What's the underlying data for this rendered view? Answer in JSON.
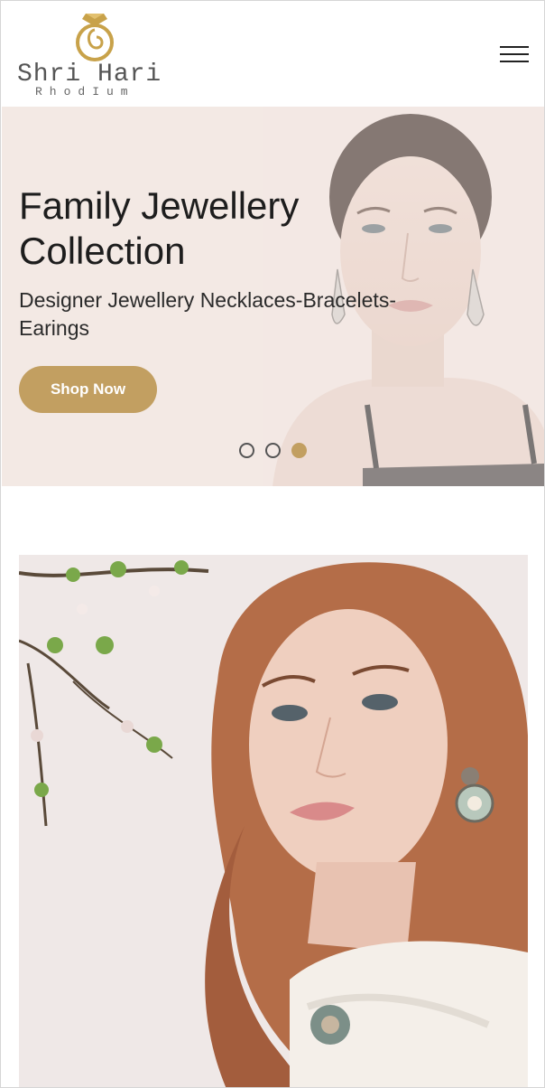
{
  "brand": {
    "name": "Shri Hari",
    "subtitle": "RhodIum",
    "accent_color": "#c29f61"
  },
  "header": {
    "menu_icon": "hamburger-menu-icon"
  },
  "hero": {
    "title": "Family Jewellery Collection",
    "subtitle": "Designer Jewellery Necklaces-Bracelets-Earings",
    "cta_label": "Shop Now",
    "slides_count": 3,
    "active_slide": 3,
    "background_color": "#f3e9e4"
  },
  "feature": {
    "image": "woman-with-floral-earrings-photo"
  }
}
